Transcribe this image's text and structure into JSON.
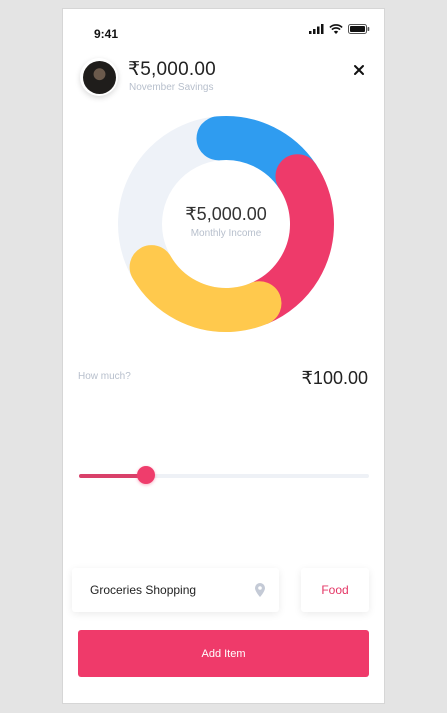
{
  "status_bar": {
    "time": "9:41",
    "icons": [
      "signal-icon",
      "wifi-icon",
      "battery-icon"
    ]
  },
  "header": {
    "avatar": "user-avatar",
    "amount": "₹5,000.00",
    "subtitle": "November Savings",
    "close_icon": "close-icon"
  },
  "budget_chart": {
    "center_amount": "₹5,000.00",
    "center_label": "Monthly Income",
    "track_color": "#eef2f8",
    "segments": [
      {
        "color": "#2f9cf0",
        "fraction": 0.17
      },
      {
        "color": "#ee3a6a",
        "fraction": 0.28
      },
      {
        "color": "#ffc94d",
        "fraction": 0.23
      }
    ]
  },
  "amount_input": {
    "label": "How much?",
    "value": "₹100.00"
  },
  "slider": {
    "value_fraction": 0.23,
    "fill_color": "#d9416a",
    "thumb_color": "#ef3d6c"
  },
  "item": {
    "name": "Groceries Shopping",
    "icon": "location-pin-icon",
    "category": "Food"
  },
  "actions": {
    "add_label": "Add Item",
    "accent": "#ef3a6a"
  }
}
